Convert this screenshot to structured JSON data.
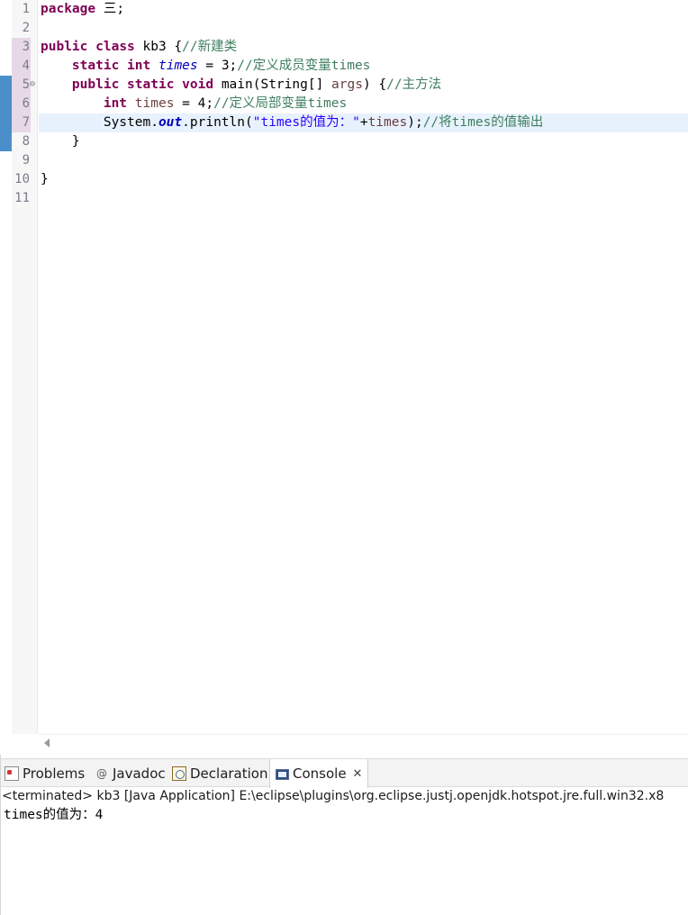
{
  "editor": {
    "line_numbers": [
      "1",
      "2",
      "3",
      "4",
      "5",
      "6",
      "7",
      "8",
      "9",
      "10",
      "11"
    ],
    "lines": [
      [
        {
          "t": "package",
          "c": "kw"
        },
        {
          "t": " 三;"
        }
      ],
      [],
      [
        {
          "t": "public",
          "c": "kw"
        },
        {
          "t": " "
        },
        {
          "t": "class",
          "c": "kw"
        },
        {
          "t": " kb3 {"
        },
        {
          "t": "//新建类",
          "c": "cmt"
        }
      ],
      [
        {
          "t": "    "
        },
        {
          "t": "static",
          "c": "kw"
        },
        {
          "t": " "
        },
        {
          "t": "int",
          "c": "kw"
        },
        {
          "t": " "
        },
        {
          "t": "times",
          "c": "fld"
        },
        {
          "t": " = 3;"
        },
        {
          "t": "//定义成员变量times",
          "c": "cmt"
        }
      ],
      [
        {
          "t": "    "
        },
        {
          "t": "public",
          "c": "kw"
        },
        {
          "t": " "
        },
        {
          "t": "static",
          "c": "kw"
        },
        {
          "t": " "
        },
        {
          "t": "void",
          "c": "kw"
        },
        {
          "t": " main(String[] "
        },
        {
          "t": "args",
          "c": "var"
        },
        {
          "t": ") {"
        },
        {
          "t": "//主方法",
          "c": "cmt"
        }
      ],
      [
        {
          "t": "        "
        },
        {
          "t": "int",
          "c": "kw"
        },
        {
          "t": " "
        },
        {
          "t": "times",
          "c": "var"
        },
        {
          "t": " = 4;"
        },
        {
          "t": "//定义局部变量times",
          "c": "cmt"
        }
      ],
      [
        {
          "t": "        System."
        },
        {
          "t": "out",
          "c": "sfld"
        },
        {
          "t": ".println("
        },
        {
          "t": "\"times的值为：\"",
          "c": "str"
        },
        {
          "t": "+"
        },
        {
          "t": "times",
          "c": "var"
        },
        {
          "t": ");"
        },
        {
          "t": "//将times的值输出",
          "c": "cmt"
        }
      ],
      [
        {
          "t": "    }"
        }
      ],
      [],
      [
        {
          "t": "}"
        }
      ],
      []
    ]
  },
  "panel": {
    "tabs": [
      {
        "label": "Problems",
        "icon": "problems-icon"
      },
      {
        "label": "Javadoc",
        "icon": "javadoc-icon"
      },
      {
        "label": "Declaration",
        "icon": "declaration-icon"
      },
      {
        "label": "Console",
        "icon": "console-icon",
        "close": "✕"
      }
    ],
    "javadoc_glyph": "@",
    "console_status": "<terminated> kb3 [Java Application] E:\\eclipse\\plugins\\org.eclipse.justj.openjdk.hotspot.jre.full.win32.x8",
    "console_output": "times的值为：4"
  }
}
